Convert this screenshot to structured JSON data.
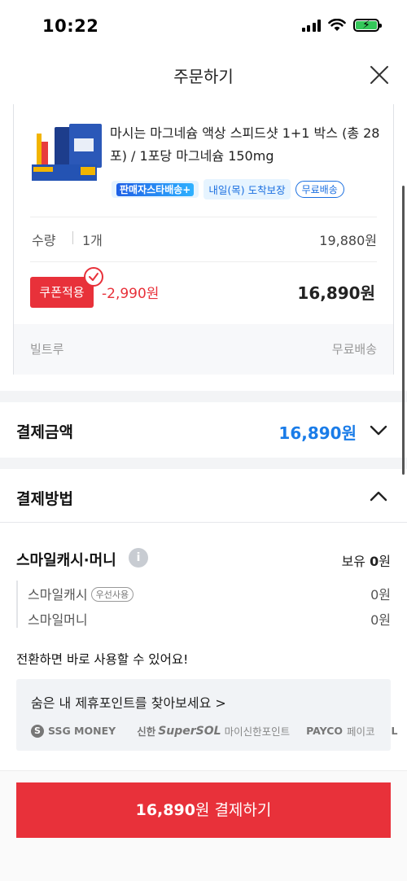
{
  "status_bar": {
    "time": "10:22"
  },
  "header": {
    "title": "주문하기"
  },
  "product": {
    "name": "마시는 마그네슘 액상 스피드샷 1+1 박스 (총 28포) / 1포당 마그네슘 150mg",
    "tag_star": "판매자스타배송+",
    "tag_delivery": "내일(목) 도착보장",
    "tag_free": "무료배송",
    "qty_label": "수량",
    "qty_value": "1개",
    "price": "19,880원",
    "coupon_label": "쿠폰적용",
    "coupon_discount": "-2,990원",
    "final_price": "16,890원",
    "seller": "빌트루",
    "shipping": "무료배송"
  },
  "payment_amount": {
    "title": "결제금액",
    "value": "16,890원"
  },
  "payment_method": {
    "title": "결제방법"
  },
  "smile": {
    "title": "스마일캐시·머니",
    "holding_label": "보유",
    "holding_value": "0",
    "holding_unit": "원",
    "cash_label": "스마일캐시",
    "cash_badge": "우선사용",
    "cash_amount": "0원",
    "money_label": "스마일머니",
    "money_amount": "0원"
  },
  "switch_note": "전환하면 바로 사용할 수 있어요!",
  "promo": {
    "link": "숨은 내 제휴포인트를 찾아보세요 >",
    "partner_ssg": "SSG MONEY",
    "partner_shinhan_a": "신한",
    "partner_shinhan_b": "SuperSOL",
    "partner_shinhan_c": "마이신한포인트",
    "partner_payco_a": "PAYCO",
    "partner_payco_b": "페이코",
    "partner_more": "L"
  },
  "pay_button": {
    "amount": "16,890",
    "suffix": "원 결제하기"
  },
  "colors": {
    "accent_red": "#e8313a",
    "accent_blue": "#1a7ce8"
  }
}
